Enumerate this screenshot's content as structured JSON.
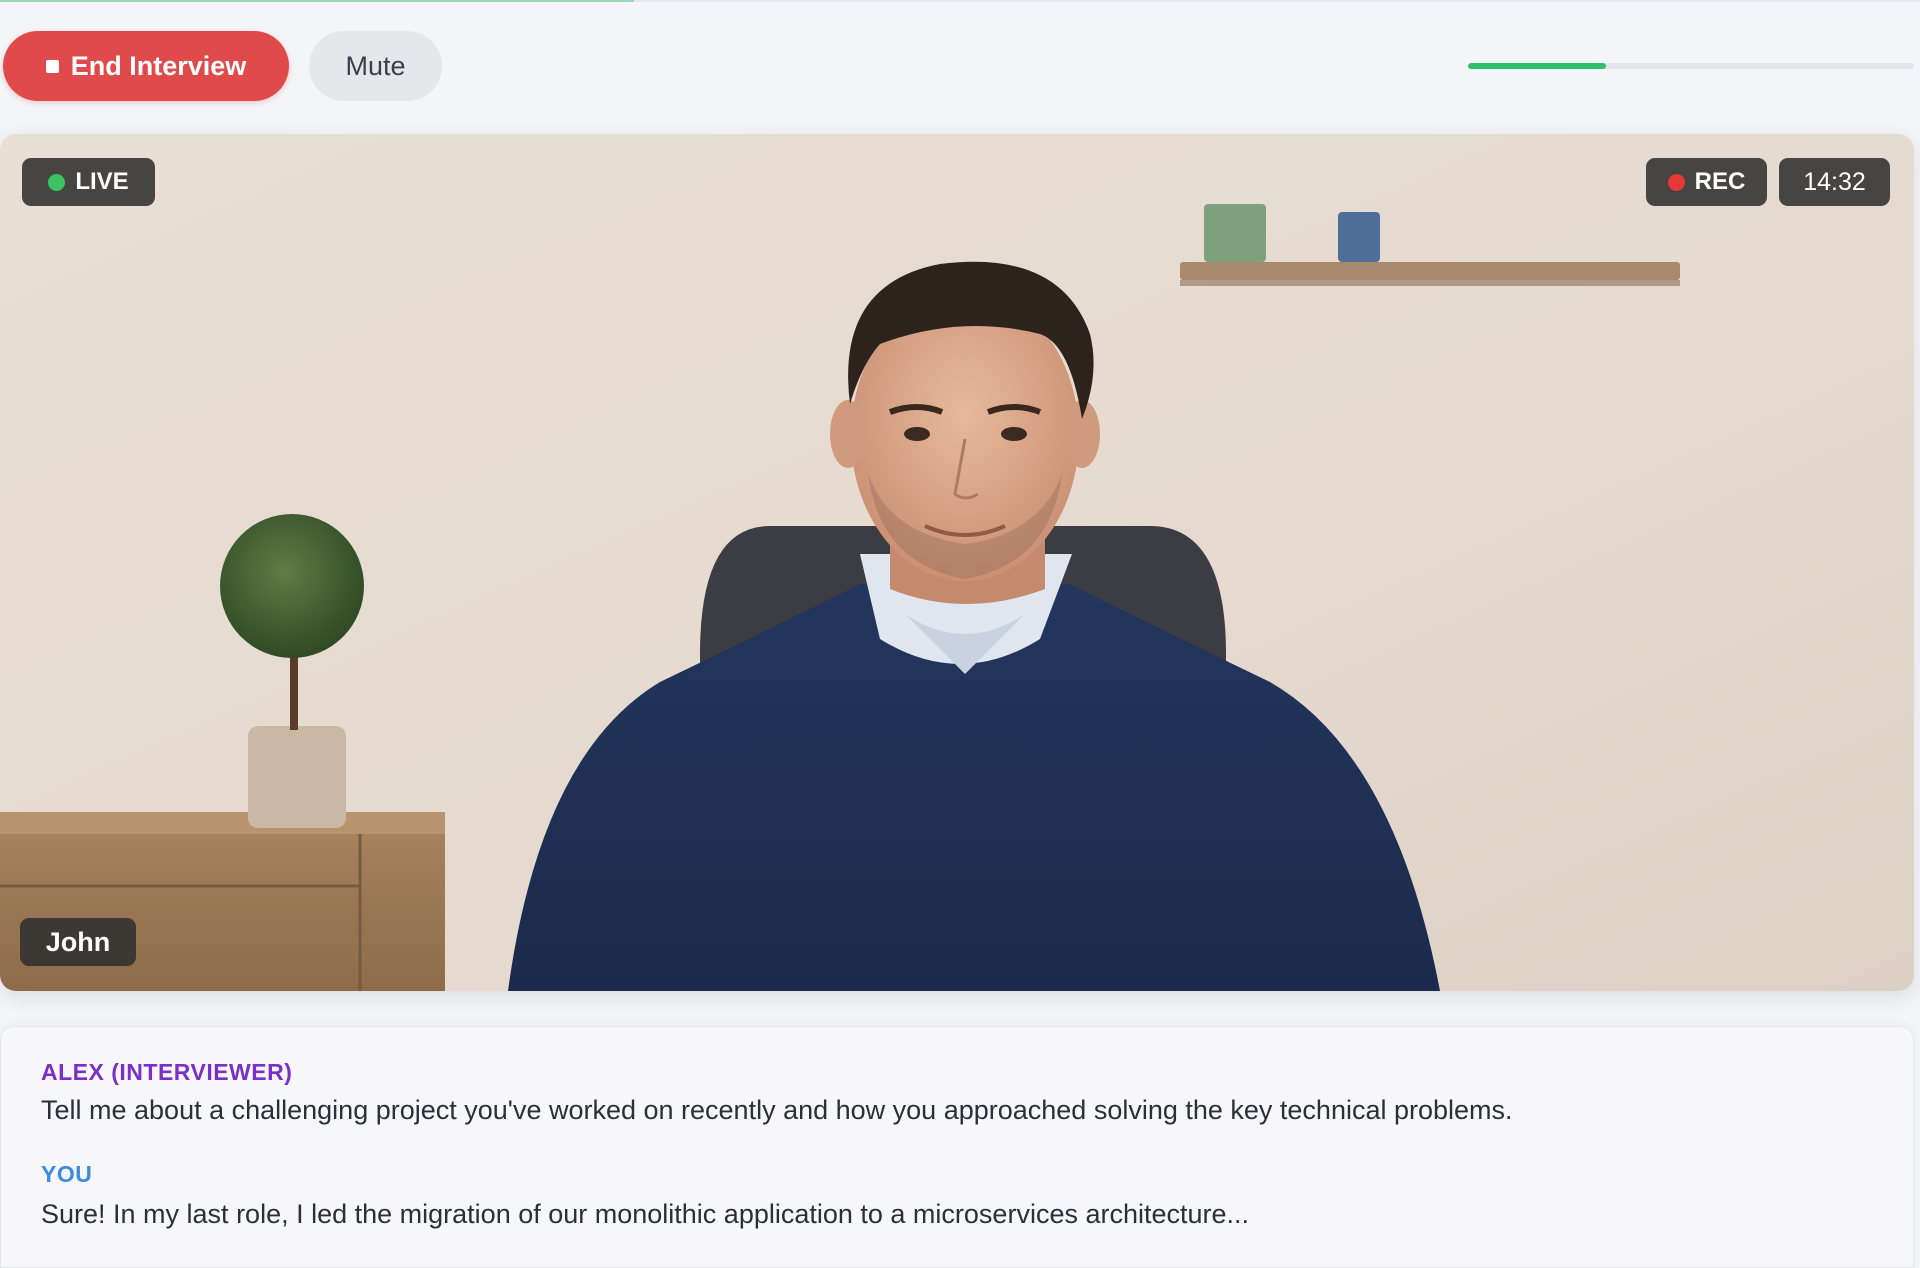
{
  "toolbar": {
    "end_label": "End Interview",
    "mute_label": "Mute",
    "session_progress": 0.31,
    "top_progress": 0.33
  },
  "video": {
    "live_label": "LIVE",
    "rec_label": "REC",
    "timer": "14:32",
    "participant_name": "John"
  },
  "transcript": {
    "entries": [
      {
        "speaker": "ALEX (INTERVIEWER)",
        "text": "Tell me about a challenging project you've worked on recently and how you approached solving the key technical problems."
      },
      {
        "speaker": "YOU",
        "text": "Sure! In my last role, I led the migration of our monolithic application to a microservices architecture..."
      }
    ]
  },
  "colors": {
    "end_button": "#e04a4a",
    "live_dot": "#3cc25f",
    "rec_dot": "#e53935",
    "progress_fill": "#2fbf6a",
    "interviewer_label": "#7b2fc9",
    "you_label": "#3c8be0"
  },
  "icons": {
    "end": "stop-icon",
    "live": "live-dot-icon",
    "rec": "rec-dot-icon"
  }
}
